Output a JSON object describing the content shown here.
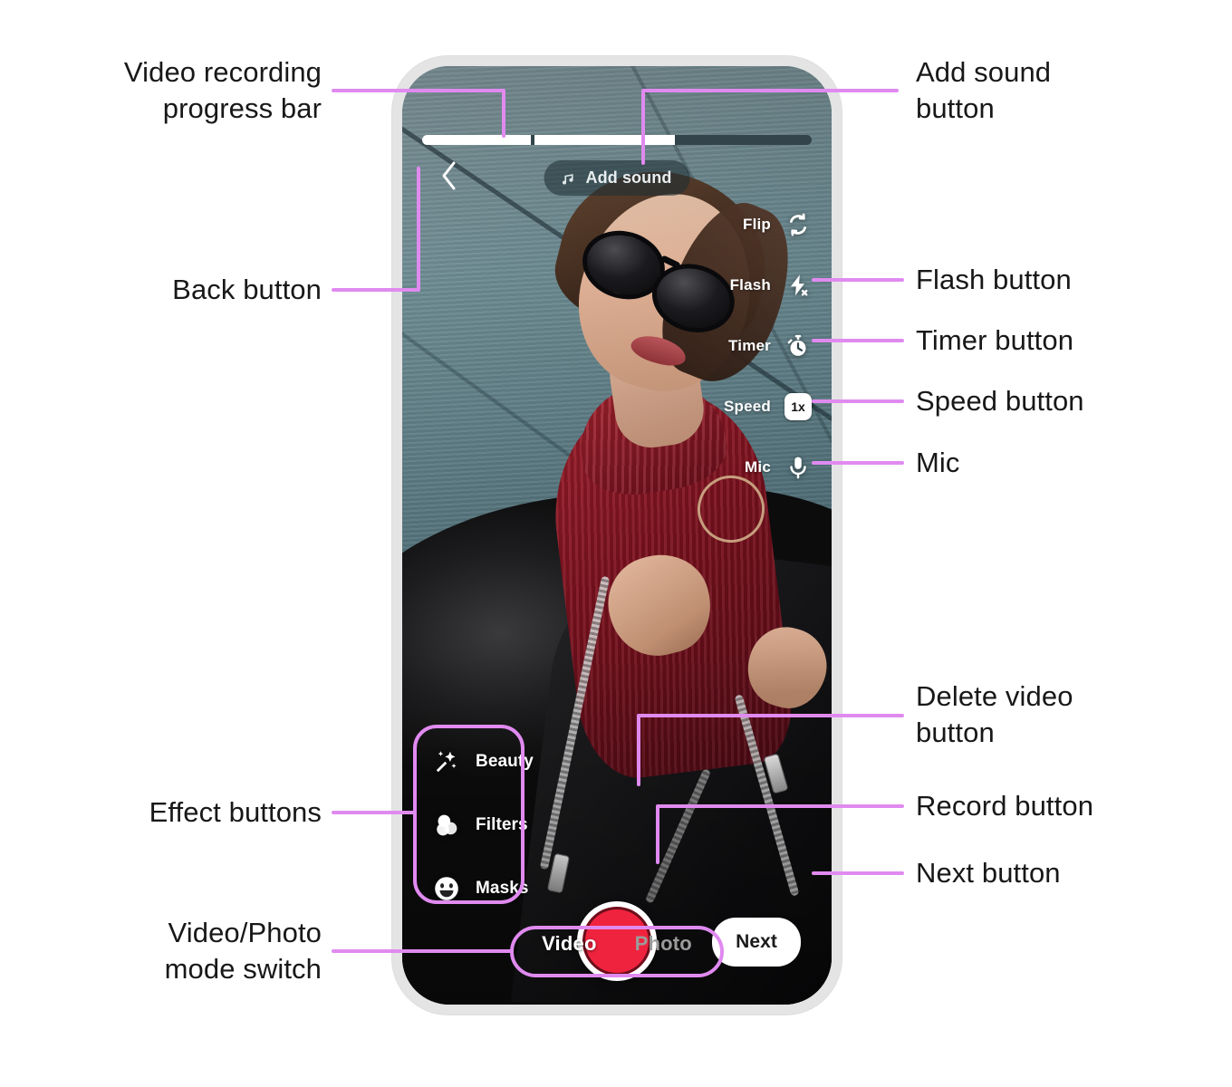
{
  "accent_color": "#e08af0",
  "record_color": "#f0233e",
  "phone_frame_color": "#e4e4e4",
  "annotations": [
    {
      "id": "progress-bar",
      "text": "Video recording\nprogress bar",
      "side": "left"
    },
    {
      "id": "back-button",
      "text": "Back button",
      "side": "left"
    },
    {
      "id": "effect-buttons",
      "text": "Effect buttons",
      "side": "left"
    },
    {
      "id": "mode-switch",
      "text": "Video/Photo\nmode switch",
      "side": "left"
    },
    {
      "id": "add-sound",
      "text": "Add sound\nbutton",
      "side": "right"
    },
    {
      "id": "flash",
      "text": "Flash button",
      "side": "right"
    },
    {
      "id": "timer",
      "text": "Timer button",
      "side": "right"
    },
    {
      "id": "speed",
      "text": "Speed button",
      "side": "right"
    },
    {
      "id": "mic",
      "text": "Mic",
      "side": "right"
    },
    {
      "id": "delete",
      "text": "Delete video\nbutton",
      "side": "right"
    },
    {
      "id": "record",
      "text": "Record button",
      "side": "right"
    },
    {
      "id": "next",
      "text": "Next button",
      "side": "right"
    }
  ],
  "screen": {
    "progress": {
      "segments": [
        {
          "percent": 29
        },
        {
          "percent": 36
        }
      ],
      "track_percent": 100
    },
    "add_sound": {
      "label": "Add sound",
      "icon": "music-note-icon"
    },
    "back": {
      "icon": "chevron-left-icon"
    },
    "controls": [
      {
        "label": "Flip",
        "icon": "flip-camera-icon",
        "value": ""
      },
      {
        "label": "Flash",
        "icon": "flash-off-icon",
        "value": ""
      },
      {
        "label": "Timer",
        "icon": "timer-icon",
        "value": ""
      },
      {
        "label": "Speed",
        "icon": "speed-icon",
        "value": "1x"
      },
      {
        "label": "Mic",
        "icon": "microphone-icon",
        "value": ""
      }
    ],
    "effects": [
      {
        "label": "Beauty",
        "icon": "magic-wand-icon"
      },
      {
        "label": "Filters",
        "icon": "filters-icon"
      },
      {
        "label": "Masks",
        "icon": "smiley-mask-icon"
      }
    ],
    "delete": {
      "icon": "backspace-delete-icon"
    },
    "record": {
      "icon": "record-circle-icon"
    },
    "next": {
      "label": "Next"
    },
    "mode_switch": {
      "options": [
        {
          "label": "Video",
          "active": true
        },
        {
          "label": "Photo",
          "active": false
        }
      ]
    }
  }
}
